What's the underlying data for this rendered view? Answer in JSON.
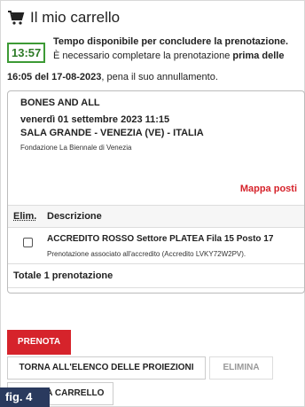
{
  "header": {
    "title": "Il mio carrello",
    "icon": "shopping-cart-icon"
  },
  "timer": {
    "time": "13:57",
    "line1": "Tempo disponibile per concludere la prenotazione.",
    "line2_prefix": "È necessario completare la prenotazione ",
    "line2_bold": "prima delle",
    "line3_bold": "16:05 del 17-08-2023",
    "line3_suffix": ", pena il suo annullamento.",
    "color": "#3d9a35"
  },
  "event": {
    "title": "BONES AND ALL",
    "date": "venerdì 01 settembre 2023 11:15",
    "place": "SALA GRANDE - VENEZIA (VE) - ITALIA",
    "organizer": "Fondazione La Biennale di Venezia",
    "seat_map_link": "Mappa posti"
  },
  "table": {
    "columns": [
      "Elim.",
      "Descrizione"
    ],
    "rows": [
      {
        "description": "ACCREDITO ROSSO Settore PLATEA Fila 15 Posto 17",
        "detail": "Prenotazione associato all'accredito (Accredito LVKY72W2PV).",
        "checked": false
      }
    ],
    "total": "Totale 1 prenotazione"
  },
  "buttons": {
    "book": "PRENOTA",
    "back": "TORNA ALL'ELENCO DELLE PROIEZIONI",
    "delete": "ELIMINA",
    "empty_cart": "SVUOTA CARRELLO"
  },
  "figure_label": "fig. 4",
  "colors": {
    "accent": "#d6232b",
    "timer": "#3d9a35",
    "figure_label_bg": "#2a3a5e"
  }
}
